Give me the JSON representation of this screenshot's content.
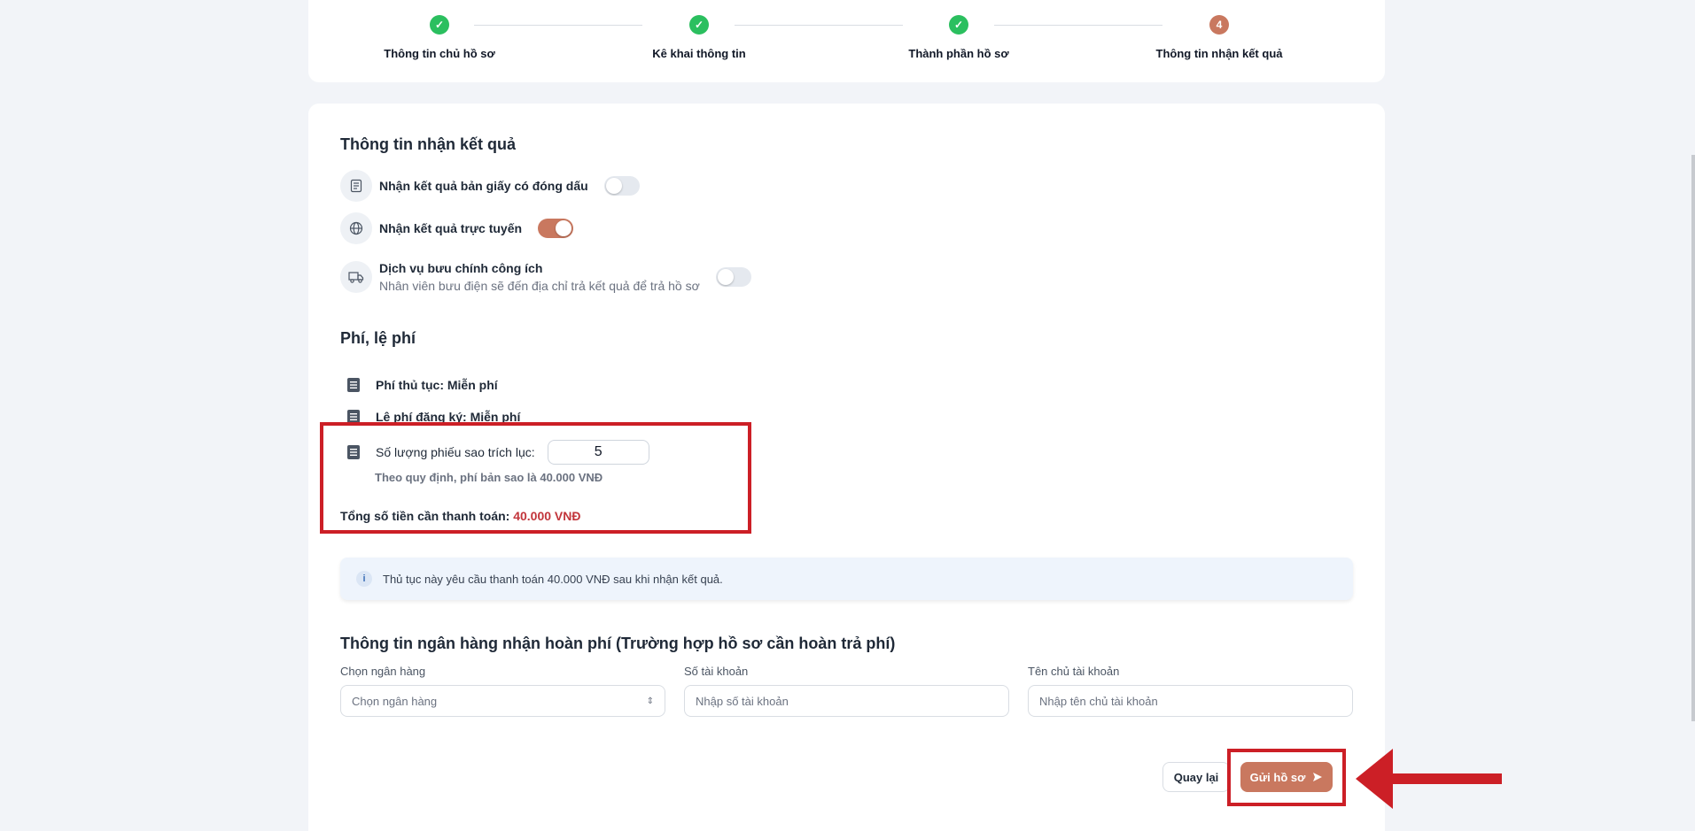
{
  "stepper": {
    "steps": [
      {
        "label": "Thông tin chủ hồ sơ",
        "number": "1",
        "done": true
      },
      {
        "label": "Kê khai thông tin",
        "number": "2",
        "done": true
      },
      {
        "label": "Thành phần hồ sơ",
        "number": "3",
        "done": true
      },
      {
        "label": "Thông tin nhận kết quả",
        "number": "4",
        "done": false
      }
    ],
    "check_icon": "check-icon"
  },
  "result_section": {
    "title": "Thông tin nhận kết quả",
    "options": [
      {
        "label": "Nhận kết quả bản giấy có đóng dấu",
        "sub": "",
        "on": false,
        "icon": "document-icon"
      },
      {
        "label": "Nhận kết quả trực tuyến",
        "sub": "",
        "on": true,
        "icon": "globe-icon"
      },
      {
        "label": "Dịch vụ bưu chính công ích",
        "sub": "Nhân viên bưu điện sẽ đến địa chỉ trả kết quả để trả hồ sơ",
        "on": false,
        "icon": "truck-icon"
      }
    ]
  },
  "fee_section": {
    "title": "Phí, lệ phí",
    "procedure_fee": "Phí thủ tục: Miễn phí",
    "registration_fee": "Lệ phí đăng ký: Miễn phí",
    "copy_count_label": "Số lượng phiếu sao trích lục:",
    "copy_count_value": "5",
    "note": "Theo quy định, phí bản sao là 40.000 VNĐ",
    "total_label": "Tổng số tiền cần thanh toán:",
    "total_amount": "40.000 VNĐ"
  },
  "info_box": {
    "text": "Thủ tục này yêu cầu thanh toán 40.000 VNĐ sau khi nhận kết quả.",
    "icon": "info-icon"
  },
  "bank_section": {
    "title": "Thông tin ngân hàng nhận hoàn phí (Trường hợp hồ sơ cần hoàn trả phí)",
    "bank_label": "Chọn ngân hàng",
    "bank_placeholder": "Chọn ngân hàng",
    "account_label": "Số tài khoản",
    "account_placeholder": "Nhập số tài khoản",
    "holder_label": "Tên chủ tài khoản",
    "holder_placeholder": "Nhập tên chủ tài khoản"
  },
  "actions": {
    "back_label": "Quay lại",
    "submit_label": "Gửi hồ sơ"
  },
  "colors": {
    "accent": "#c9785f",
    "success": "#2bbf5f",
    "highlight": "#cc1f26",
    "total_amount": "#c2353b"
  }
}
